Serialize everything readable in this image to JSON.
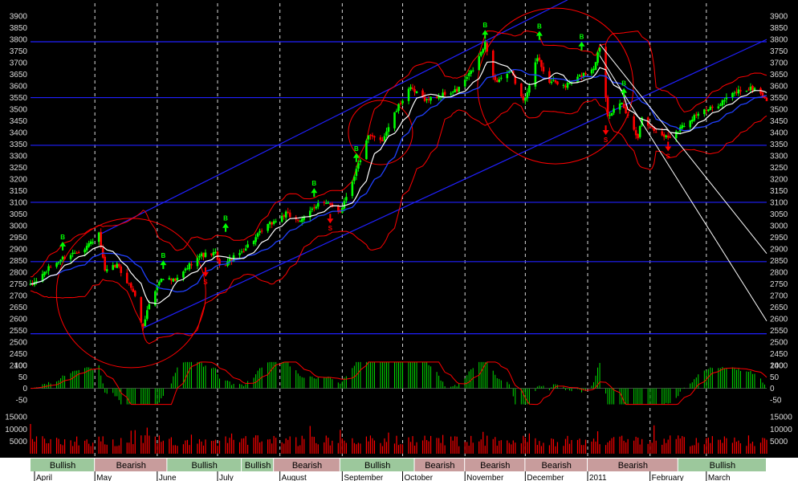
{
  "chart_data": {
    "type": "candlestick",
    "price_axis": {
      "ticks": [
        2400,
        2450,
        2500,
        2550,
        2600,
        2650,
        2700,
        2750,
        2800,
        2850,
        2900,
        2950,
        3000,
        3050,
        3100,
        3150,
        3200,
        3250,
        3300,
        3350,
        3400,
        3450,
        3500,
        3550,
        3600,
        3650,
        3700,
        3750,
        3800,
        3850,
        3900
      ],
      "ylim": [
        2375,
        3935
      ],
      "side": "both"
    },
    "oscillator_axis": {
      "ticks": [
        100,
        50,
        0,
        -50
      ],
      "ylim": [
        -75,
        125
      ]
    },
    "volume_axis": {
      "ticks": [
        15000,
        10000,
        5000
      ],
      "ylim": [
        0,
        18000
      ]
    },
    "x_range": {
      "start": "2010-03-30",
      "end": "2011-03-31"
    },
    "months": [
      {
        "label": "April",
        "date": "2010-04-01"
      },
      {
        "label": "May",
        "date": "2010-05-01"
      },
      {
        "label": "June",
        "date": "2010-06-01"
      },
      {
        "label": "July",
        "date": "2010-07-01"
      },
      {
        "label": "August",
        "date": "2010-08-01"
      },
      {
        "label": "September",
        "date": "2010-09-01"
      },
      {
        "label": "October",
        "date": "2010-10-01"
      },
      {
        "label": "November",
        "date": "2010-11-01"
      },
      {
        "label": "December",
        "date": "2010-12-01"
      },
      {
        "label": "2011",
        "date": "2011-01-01"
      },
      {
        "label": "February",
        "date": "2011-02-01"
      },
      {
        "label": "March",
        "date": "2011-03-01"
      }
    ],
    "sentiment_bands": [
      {
        "label": "Bullish",
        "start": "2010-03-30",
        "end": "2010-05-01"
      },
      {
        "label": "Bearish",
        "start": "2010-05-01",
        "end": "2010-06-06"
      },
      {
        "label": "Bullish",
        "start": "2010-06-06",
        "end": "2010-07-13"
      },
      {
        "label": "Bullish",
        "start": "2010-07-13",
        "end": "2010-07-29"
      },
      {
        "label": "Bearish",
        "start": "2010-07-29",
        "end": "2010-08-31"
      },
      {
        "label": "Bullish",
        "start": "2010-08-31",
        "end": "2010-10-07"
      },
      {
        "label": "Bearish",
        "start": "2010-10-07",
        "end": "2010-11-01"
      },
      {
        "label": "Bearish",
        "start": "2010-11-01",
        "end": "2010-12-01"
      },
      {
        "label": "Bearish",
        "start": "2010-12-01",
        "end": "2011-01-01"
      },
      {
        "label": "Bearish",
        "start": "2011-01-01",
        "end": "2011-02-15"
      },
      {
        "label": "Bullish",
        "start": "2011-02-15",
        "end": "2011-03-31"
      }
    ],
    "support_resistance_levels": [
      3790,
      3550,
      3345,
      3100,
      2845,
      2535
    ],
    "price_path": [
      [
        "2010-03-30",
        2740
      ],
      [
        "2010-04-08",
        2815
      ],
      [
        "2010-04-15",
        2860
      ],
      [
        "2010-04-26",
        2905
      ],
      [
        "2010-05-03",
        2960
      ],
      [
        "2010-05-06",
        2800
      ],
      [
        "2010-05-12",
        2830
      ],
      [
        "2010-05-20",
        2720
      ],
      [
        "2010-05-25",
        2560
      ],
      [
        "2010-05-27",
        2640
      ],
      [
        "2010-06-03",
        2780
      ],
      [
        "2010-06-10",
        2760
      ],
      [
        "2010-06-21",
        2870
      ],
      [
        "2010-06-30",
        2880
      ],
      [
        "2010-07-02",
        2820
      ],
      [
        "2010-07-12",
        2880
      ],
      [
        "2010-07-26",
        3000
      ],
      [
        "2010-08-04",
        3050
      ],
      [
        "2010-08-06",
        3040
      ],
      [
        "2010-08-12",
        3020
      ],
      [
        "2010-08-20",
        3100
      ],
      [
        "2010-08-25",
        3090
      ],
      [
        "2010-08-31",
        3060
      ],
      [
        "2010-09-08",
        3240
      ],
      [
        "2010-09-14",
        3380
      ],
      [
        "2010-09-21",
        3370
      ],
      [
        "2010-09-27",
        3480
      ],
      [
        "2010-10-04",
        3590
      ],
      [
        "2010-10-13",
        3540
      ],
      [
        "2010-10-20",
        3560
      ],
      [
        "2010-10-28",
        3580
      ],
      [
        "2010-11-05",
        3670
      ],
      [
        "2010-11-11",
        3780
      ],
      [
        "2010-11-16",
        3620
      ],
      [
        "2010-11-24",
        3660
      ],
      [
        "2010-11-30",
        3530
      ],
      [
        "2010-12-07",
        3720
      ],
      [
        "2010-12-13",
        3620
      ],
      [
        "2010-12-21",
        3600
      ],
      [
        "2011-01-04",
        3680
      ],
      [
        "2011-01-07",
        3770
      ],
      [
        "2011-01-11",
        3480
      ],
      [
        "2011-01-18",
        3520
      ],
      [
        "2011-01-26",
        3380
      ],
      [
        "2011-01-28",
        3470
      ],
      [
        "2011-02-04",
        3400
      ],
      [
        "2011-02-10",
        3380
      ],
      [
        "2011-02-16",
        3420
      ],
      [
        "2011-02-24",
        3480
      ],
      [
        "2011-03-03",
        3500
      ],
      [
        "2011-03-10",
        3540
      ],
      [
        "2011-03-17",
        3580
      ],
      [
        "2011-03-25",
        3590
      ],
      [
        "2011-03-31",
        3540
      ]
    ],
    "buy_signals": [
      {
        "label": "B",
        "date": "2010-04-15",
        "price": 2900
      },
      {
        "label": "B",
        "date": "2010-06-04",
        "price": 2820
      },
      {
        "label": "B",
        "date": "2010-07-05",
        "price": 2980
      },
      {
        "label": "B",
        "date": "2010-08-18",
        "price": 3130
      },
      {
        "label": "B",
        "date": "2010-09-08",
        "price": 3280
      },
      {
        "label": "B",
        "date": "2010-11-11",
        "price": 3810
      },
      {
        "label": "B",
        "date": "2010-12-08",
        "price": 3805
      },
      {
        "label": "B",
        "date": "2010-12-29",
        "price": 3760
      },
      {
        "label": "B",
        "date": "2011-01-19",
        "price": 3560
      }
    ],
    "sell_signals": [
      {
        "label": "S",
        "date": "2010-06-25",
        "price": 2800
      },
      {
        "label": "S",
        "date": "2010-08-26",
        "price": 3030
      },
      {
        "label": "S",
        "date": "2011-01-10",
        "price": 3410
      },
      {
        "label": "S",
        "date": "2011-02-10",
        "price": 3340
      }
    ],
    "annotation_circles": [
      {
        "center_date": "2010-05-19",
        "center_price": 2710
      },
      {
        "center_date": "2010-09-20",
        "center_price": 3400
      },
      {
        "center_date": "2010-12-16",
        "center_price": 3600
      }
    ],
    "trend_channel": {
      "upper": [
        [
          "2010-05-03",
          2960
        ],
        [
          "2010-12-22",
          3970
        ]
      ],
      "lower": [
        [
          "2010-05-25",
          2560
        ],
        [
          "2011-03-31",
          3800
        ]
      ]
    },
    "downtrend_lines": [
      [
        [
          "2011-01-07",
          3780
        ],
        [
          "2011-03-31",
          2880
        ]
      ],
      [
        [
          "2011-01-07",
          3730
        ],
        [
          "2011-03-31",
          2590
        ]
      ]
    ],
    "colors": {
      "background": "#000000",
      "grid": "#ffffff",
      "levels": "#2020ff",
      "channel": "#2020ff",
      "bands": "#ff0000",
      "circles": "#ff0000",
      "candle_up": "#00ff00",
      "candle_down": "#ff0000",
      "ma_fast": "#ffffff",
      "ma_slow": "#2040ff",
      "buy": "#00ff00",
      "sell": "#ff0000",
      "oscillator_bars": "#00dd00",
      "oscillator_line": "#ff0000",
      "volume": "#ff0000",
      "axis_text": "#dcdcdc",
      "strip": "#ffffff"
    }
  }
}
